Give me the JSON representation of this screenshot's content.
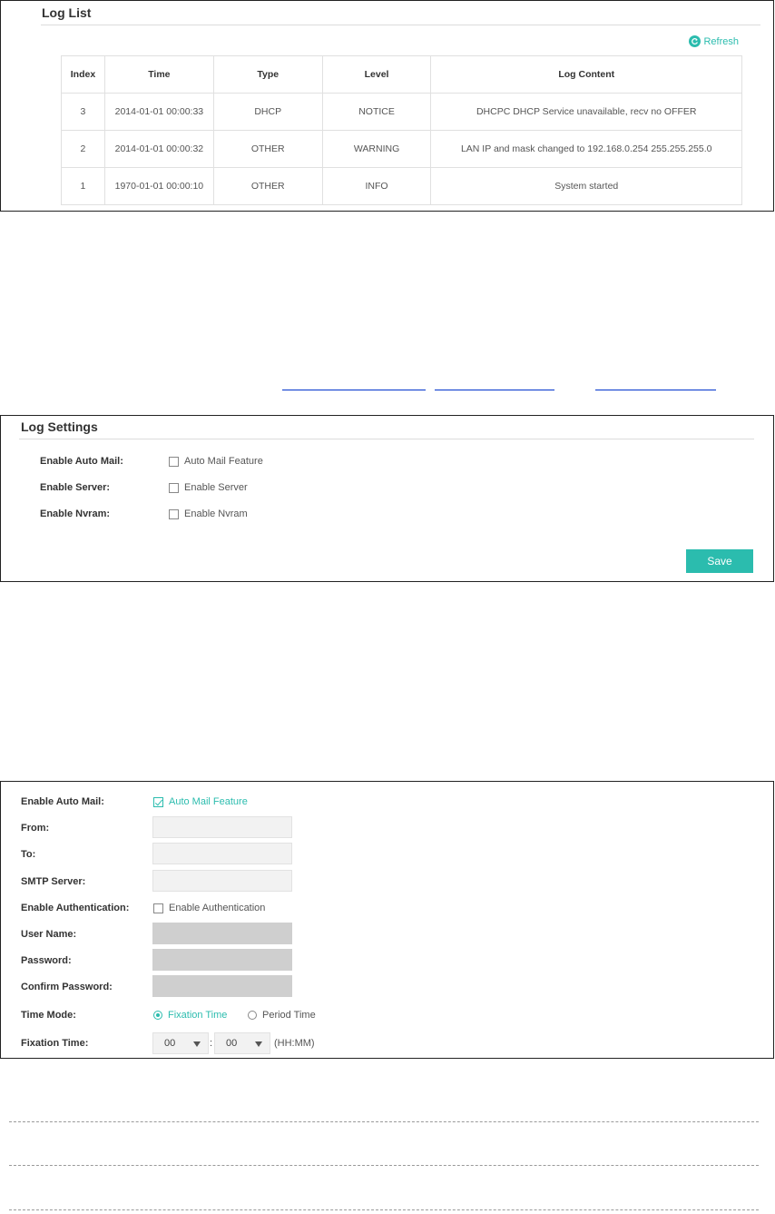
{
  "log_list": {
    "title": "Log List",
    "refresh_label": "Refresh",
    "columns": [
      "Index",
      "Time",
      "Type",
      "Level",
      "Log Content"
    ],
    "rows": [
      [
        "3",
        "2014-01-01 00:00:33",
        "DHCP",
        "NOTICE",
        "DHCPC DHCP Service unavailable, recv no OFFER"
      ],
      [
        "2",
        "2014-01-01 00:00:32",
        "OTHER",
        "WARNING",
        "LAN IP and mask changed to 192.168.0.254 255.255.255.0"
      ],
      [
        "1",
        "1970-01-01 00:00:10",
        "OTHER",
        "INFO",
        "System started"
      ]
    ]
  },
  "log_settings": {
    "title": "Log Settings",
    "auto_mail_label": "Enable Auto Mail:",
    "auto_mail_option": "Auto Mail Feature",
    "server_label": "Enable Server:",
    "server_option": "Enable Server",
    "nvram_label": "Enable Nvram:",
    "nvram_option": "Enable Nvram",
    "save_label": "Save"
  },
  "mail_settings": {
    "auto_mail_label": "Enable Auto Mail:",
    "auto_mail_option": "Auto Mail Feature",
    "auto_mail_checked": true,
    "from_label": "From:",
    "to_label": "To:",
    "smtp_label": "SMTP Server:",
    "auth_label": "Enable Authentication:",
    "auth_option": "Enable Authentication",
    "username_label": "User Name:",
    "password_label": "Password:",
    "confirm_label": "Confirm Password:",
    "time_mode_label": "Time Mode:",
    "time_mode_options": [
      "Fixation Time",
      "Period Time"
    ],
    "time_mode_selected": "Fixation Time",
    "fixation_label": "Fixation Time:",
    "hour_value": "00",
    "minute_value": "00",
    "separator": ":",
    "format_hint": "(HH:MM)"
  },
  "colors": {
    "accent": "#2bbcae",
    "link": "#0033cc"
  }
}
